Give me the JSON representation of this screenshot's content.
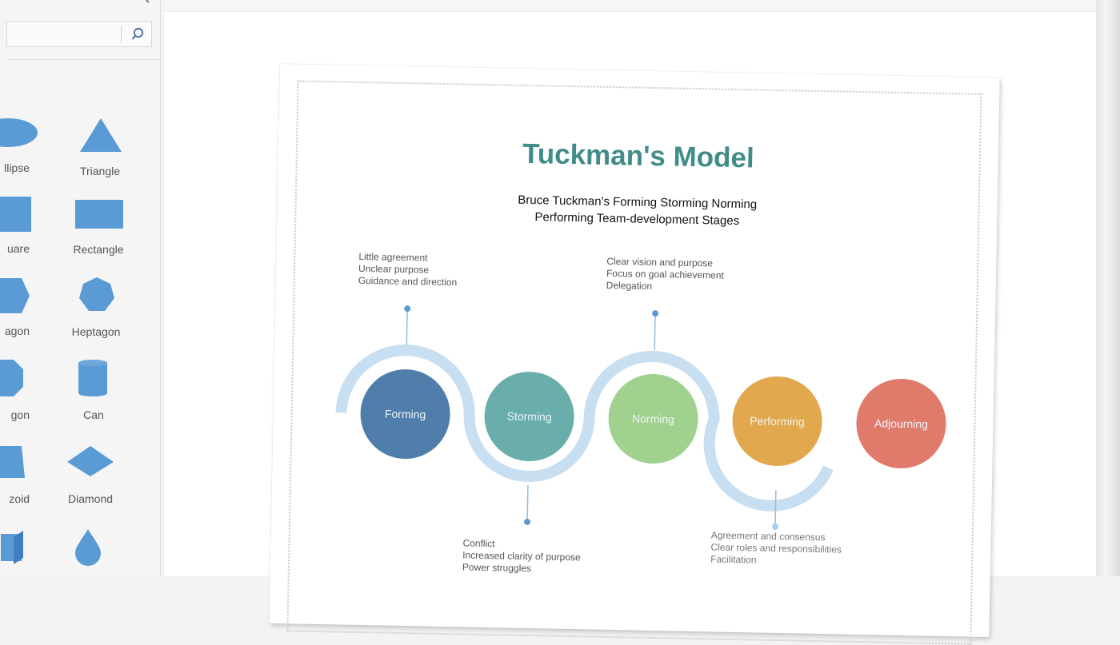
{
  "sidebar": {
    "search": {
      "value": "",
      "placeholder": ""
    },
    "shapes": [
      {
        "name": "ellipse",
        "label": "Ellipse"
      },
      {
        "name": "triangle",
        "label": "Triangle"
      },
      {
        "name": "square",
        "label": "Square"
      },
      {
        "name": "rectangle",
        "label": "Rectangle"
      },
      {
        "name": "hexagon",
        "label": "Hexagon"
      },
      {
        "name": "heptagon",
        "label": "Heptagon"
      },
      {
        "name": "octagon",
        "label": "Octagon"
      },
      {
        "name": "can",
        "label": "Can"
      },
      {
        "name": "trapezoid",
        "label": "Trapezoid"
      },
      {
        "name": "diamond",
        "label": "Diamond"
      },
      {
        "name": "cube",
        "label": ""
      },
      {
        "name": "drop",
        "label": ""
      }
    ],
    "visible_labels": [
      "llipse",
      "Triangle",
      "uare",
      "Rectangle",
      "agon",
      "Heptagon",
      "gon",
      "Can",
      "zoid",
      "Diamond"
    ],
    "shape_color": "#5b9bd5"
  },
  "diagram": {
    "title": "Tuckman's Model",
    "subtitle_line1": "Bruce Tuckman's Forming Storming Norming",
    "subtitle_line2": "Performing Team-development Stages",
    "track_color": "#c7dff0",
    "stages": [
      {
        "label": "Forming",
        "color": "#4e7ea9",
        "notes": [
          "Little agreement",
          "Unclear purpose",
          "Guidance and direction"
        ],
        "notes_position": "top"
      },
      {
        "label": "Storming",
        "color": "#6aaeab",
        "notes": [
          "Conflict",
          "Increased clarity of purpose",
          "Power struggles"
        ],
        "notes_position": "bottom"
      },
      {
        "label": "Norming",
        "color": "#a1d18f",
        "notes": [
          "Clear vision and purpose",
          "Focus on goal achievement",
          "Delegation"
        ],
        "notes_position": "top"
      },
      {
        "label": "Performing",
        "color": "#e1a84d",
        "notes": [
          "Agreement and consensus",
          "Clear roles and responsibilities",
          "Facilitation"
        ],
        "notes_position": "bottom"
      },
      {
        "label": "Adjourning",
        "color": "#e07b6c",
        "notes": [],
        "notes_position": "none"
      }
    ]
  }
}
